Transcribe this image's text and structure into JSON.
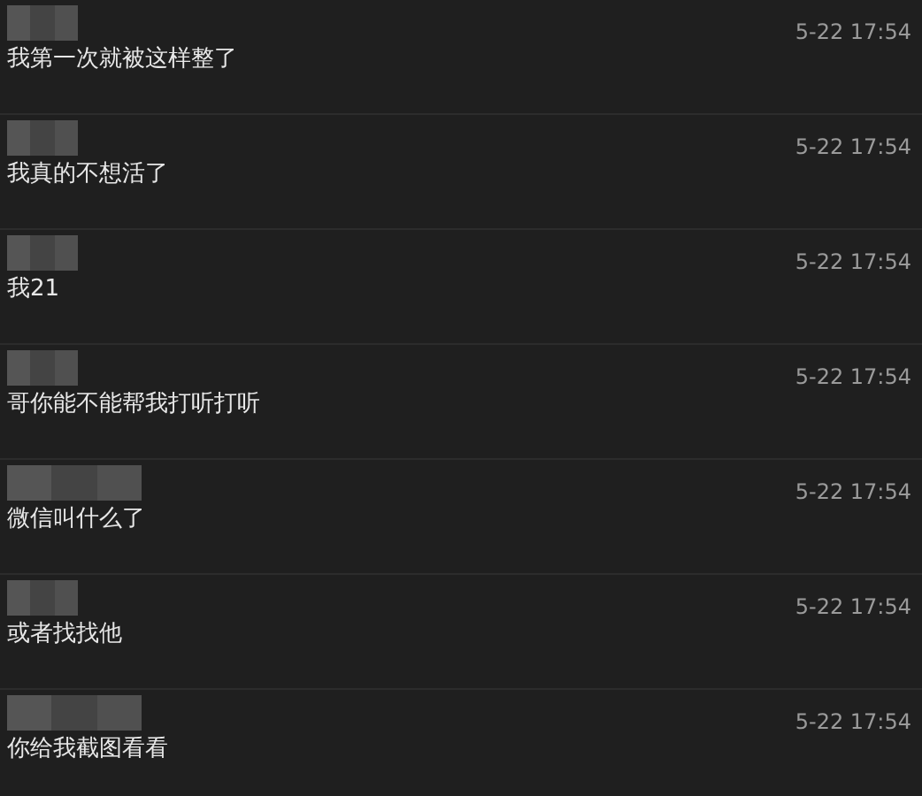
{
  "messages": [
    {
      "time": "5-22 17:54",
      "text": "我第一次就被这样整了"
    },
    {
      "time": "5-22 17:54",
      "text": "我真的不想活了"
    },
    {
      "time": "5-22 17:54",
      "text": "我21"
    },
    {
      "time": "5-22 17:54",
      "text": "哥你能不能帮我打听打听"
    },
    {
      "time": "5-22 17:54",
      "text": "微信叫什么了"
    },
    {
      "time": "5-22 17:54",
      "text": "或者找找他"
    },
    {
      "time": "5-22 17:54",
      "text": "你给我截图看看"
    }
  ]
}
